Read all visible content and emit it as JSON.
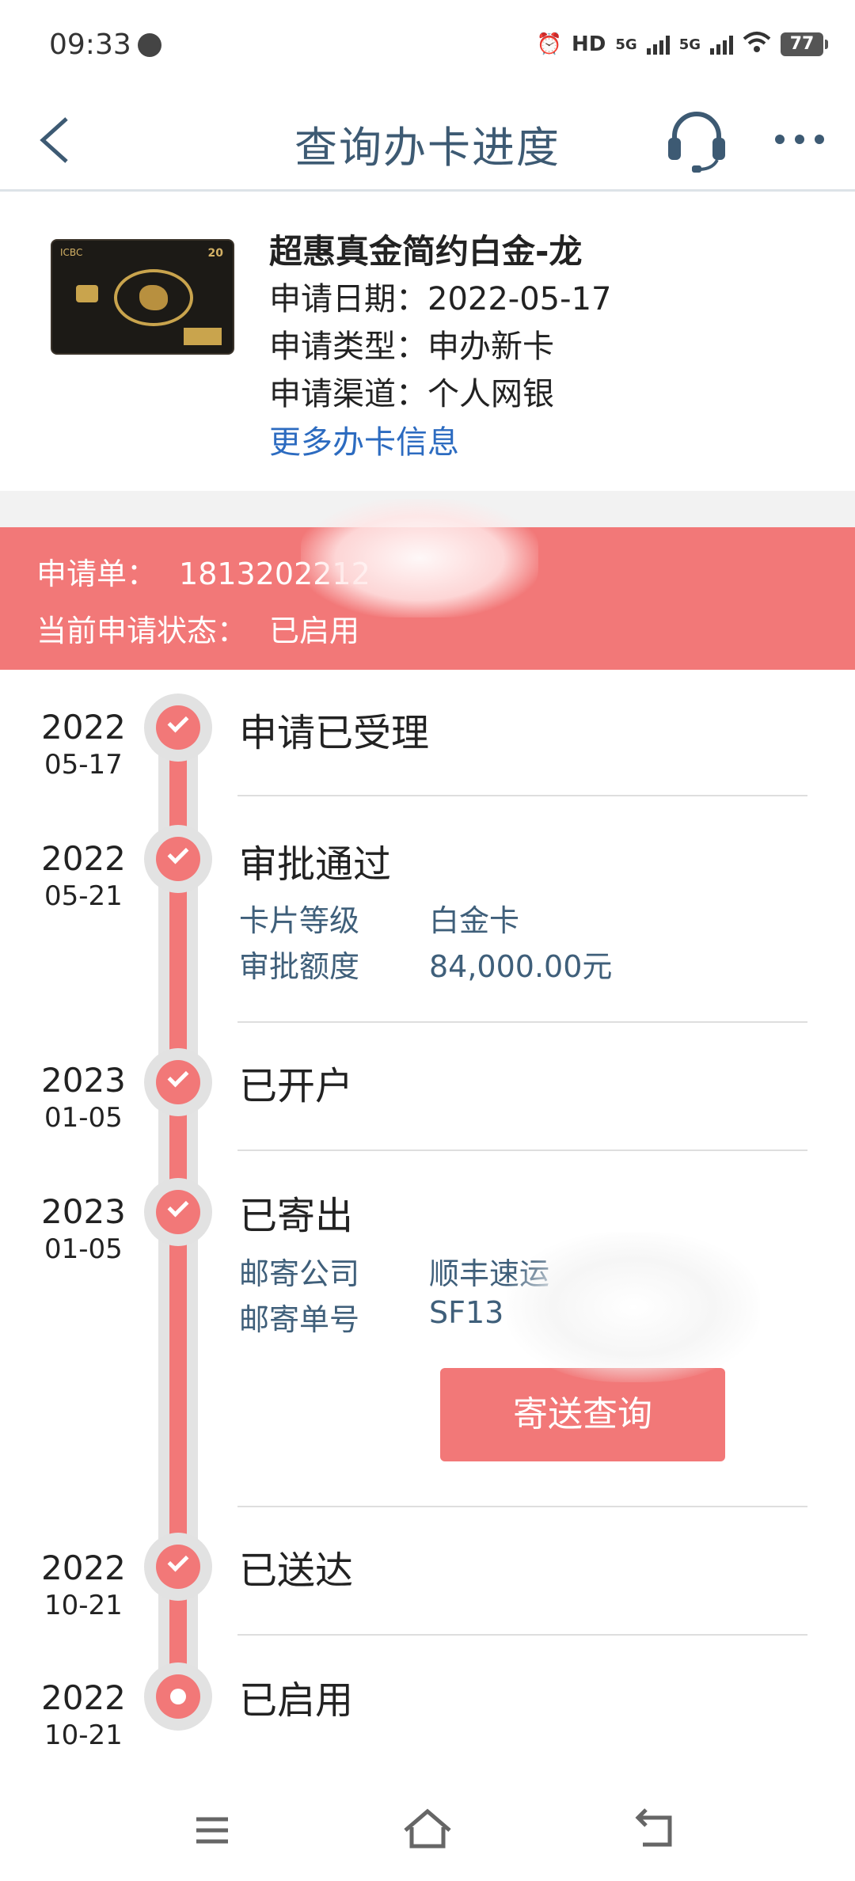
{
  "status_bar": {
    "time": "09:33",
    "hd_label": "HD",
    "net1": "5G",
    "net2": "5G",
    "battery": "77"
  },
  "header": {
    "title": "查询办卡进度",
    "back_icon": "chevron-left-icon",
    "service_icon": "headset-icon",
    "more_icon": "more-dots-icon"
  },
  "card": {
    "name": "超惠真金简约白金-龙",
    "apply_date_label": "申请日期：",
    "apply_date": "2022-05-17",
    "apply_type_label": "申请类型：",
    "apply_type": "申办新卡",
    "apply_channel_label": "申请渠道：",
    "apply_channel": "个人网银",
    "more_link": "更多办卡信息",
    "face": {
      "logo": "ICBC",
      "number": "20"
    }
  },
  "banner": {
    "order_label": "申请单：",
    "order_no": "1813202212",
    "status_label": "当前申请状态：",
    "status": "已启用"
  },
  "timeline": [
    {
      "year": "2022",
      "md": "05-17",
      "title": "申请已受理"
    },
    {
      "year": "2022",
      "md": "05-21",
      "title": "审批通过",
      "details": [
        {
          "label": "卡片等级",
          "value": "白金卡"
        },
        {
          "label": "审批额度",
          "value": "84,000.00元"
        }
      ]
    },
    {
      "year": "2023",
      "md": "01-05",
      "title": "已开户"
    },
    {
      "year": "2023",
      "md": "01-05",
      "title": "已寄出",
      "details": [
        {
          "label": "邮寄公司",
          "value": "顺丰速运"
        },
        {
          "label": "邮寄单号",
          "value": "SF13"
        }
      ],
      "button": "寄送查询"
    },
    {
      "year": "2022",
      "md": "10-21",
      "title": "已送达"
    },
    {
      "year": "2022",
      "md": "10-21",
      "title": "已启用"
    }
  ],
  "colors": {
    "accent": "#f27878",
    "title": "#3d5a73",
    "link": "#2c6bc0",
    "detail": "#3f5f7a"
  },
  "nav": {
    "menu_icon": "menu-icon",
    "home_icon": "home-icon",
    "back_icon": "return-icon"
  }
}
